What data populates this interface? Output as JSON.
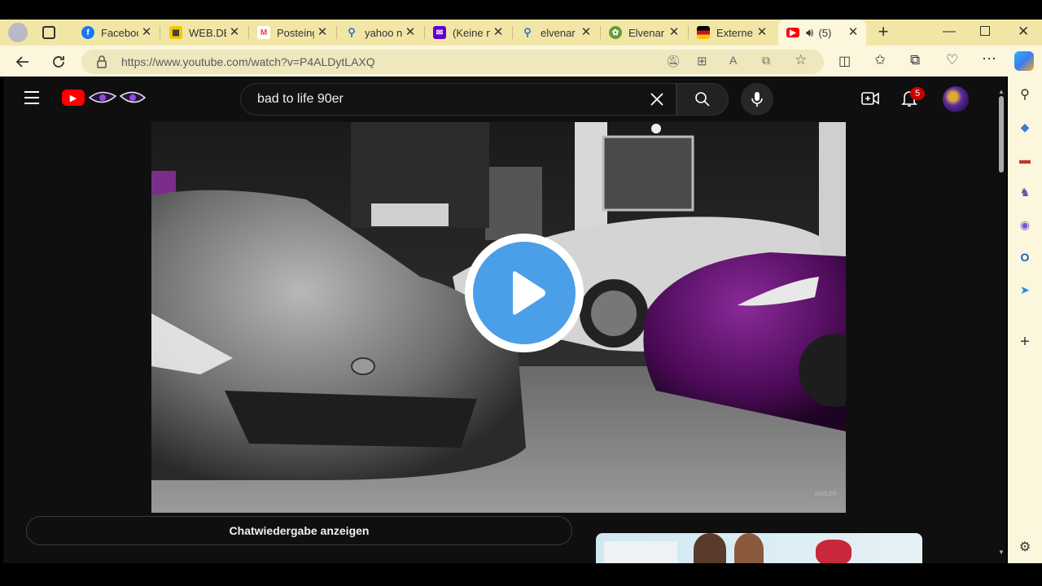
{
  "tabs": [
    {
      "label": "Faceboo",
      "icon": "facebook-icon",
      "color": "#1877f2"
    },
    {
      "label": "WEB.DE",
      "icon": "webde-icon",
      "color": "#f7c600"
    },
    {
      "label": "Posteing",
      "icon": "gmail-icon",
      "color": "#ea4335"
    },
    {
      "label": "yahoo n",
      "icon": "search-icon",
      "color": "#2f6fde"
    },
    {
      "label": "(Keine n",
      "icon": "mail-icon",
      "color": "#6001d2"
    },
    {
      "label": "elvenar",
      "icon": "search-icon",
      "color": "#2f6fde"
    },
    {
      "label": "Elvenar",
      "icon": "elvenar-icon",
      "color": "#6a9a3a"
    },
    {
      "label": "Externe",
      "icon": "flag-icon",
      "color": "#c8102e"
    }
  ],
  "active_tab": {
    "label": "(5)",
    "icon": "youtube-icon",
    "audio_icon": "speaker-icon"
  },
  "address": {
    "url": "https://www.youtube.com/watch?v=P4ALDytLAXQ"
  },
  "youtube": {
    "search_value": "bad to life 90er",
    "notification_count": "5",
    "chat_button": "Chatwiedergabe anzeigen",
    "watermark": "SKELER"
  },
  "colors": {
    "tabstrip": "#f2e6a6",
    "toolbar": "#fbf6dc",
    "youtube_red": "#ff0000",
    "play_blue": "#4a9fe8"
  }
}
